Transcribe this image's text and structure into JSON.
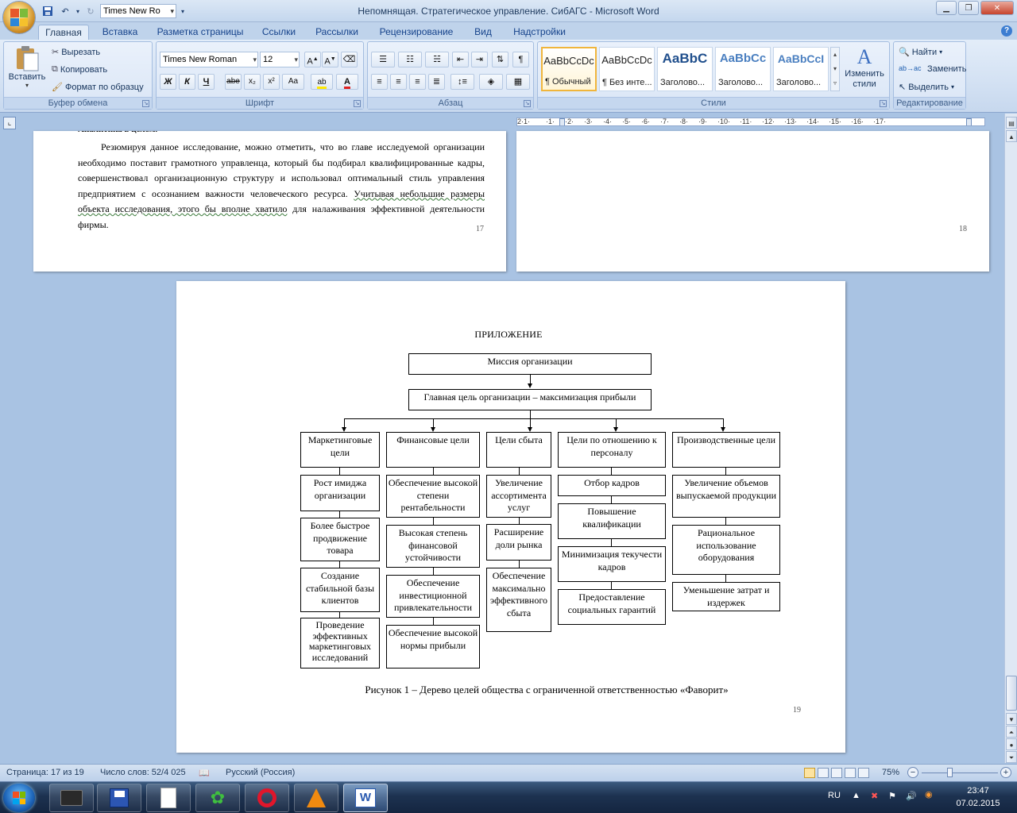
{
  "window": {
    "title": "Непомнящая. Стратегическое управление. СибАГС - Microsoft Word",
    "qat_font": "Times New Ro"
  },
  "tabs": [
    "Главная",
    "Вставка",
    "Разметка страницы",
    "Ссылки",
    "Рассылки",
    "Рецензирование",
    "Вид",
    "Надстройки"
  ],
  "ribbon": {
    "clipboard": {
      "group": "Буфер обмена",
      "paste": "Вставить",
      "cut": "Вырезать",
      "copy": "Копировать",
      "format_painter": "Формат по образцу"
    },
    "font": {
      "group": "Шрифт",
      "name": "Times New Roman",
      "size": "12",
      "bold": "Ж",
      "italic": "К",
      "underline": "Ч",
      "strike": "abe",
      "sub": "x₂",
      "sup": "x²",
      "case": "Aa"
    },
    "paragraph": {
      "group": "Абзац"
    },
    "styles": {
      "group": "Стили",
      "items": [
        {
          "sample": "AaBbCcDc",
          "name": "¶ Обычный"
        },
        {
          "sample": "AaBbCcDc",
          "name": "¶ Без инте..."
        },
        {
          "sample": "AaBbC",
          "name": "Заголово..."
        },
        {
          "sample": "AaBbCc",
          "name": "Заголово..."
        },
        {
          "sample": "AaBbCcI",
          "name": "Заголово..."
        }
      ],
      "change": "Изменить стили"
    },
    "editing": {
      "group": "Редактирование",
      "find": "Найти",
      "replace": "Заменить",
      "select": "Выделить"
    }
  },
  "pages": {
    "p17": {
      "cut_line": "Аналитика в целом.",
      "para_a": "Резюмируя данное исследование, можно отметить, что во главе исследуемой организации необходимо поставит грамотного управленца, который бы подбирал квалифицированные кадры, совершенствовал организационную структуру и использовал оптимальный стиль управления предприятием с осознанием важности человеческого ресурса.",
      "para_b": "Учитывая небольшие размеры объекта исследования, этого бы вполне хватило",
      "para_c": "для налаживания эффективной деятельности фирмы.",
      "number": "17"
    },
    "p18": {
      "number": "18"
    },
    "p19": {
      "heading": "ПРИЛОЖЕНИЕ",
      "mission": "Миссия организации",
      "main_goal": "Главная цель организации – максимизация прибыли",
      "columns": [
        {
          "title": "Маркетинговые цели",
          "items": [
            "Рост имиджа организации",
            "Более быстрое продвижение товара",
            "Создание стабильной базы клиентов",
            "Проведение эффективных маркетинговых исследований"
          ]
        },
        {
          "title": "Финансовые цели",
          "items": [
            "Обеспечение высокой степени рентабельности",
            "Высокая степень финансовой устойчивости",
            "Обеспечение инвестиционной привлекательности",
            "Обеспечение высокой нормы прибыли"
          ]
        },
        {
          "title": "Цели сбыта",
          "items": [
            "Увеличение ассортимента услуг",
            "Расширение доли рынка",
            "Обеспечение максимально эффективного сбыта"
          ]
        },
        {
          "title": "Цели по отношению к персоналу",
          "items": [
            "Отбор кадров",
            "Повышение квалификации",
            "Минимизация текучести кадров",
            "Предоставление социальных гарантий"
          ]
        },
        {
          "title": "Производственные цели",
          "items": [
            "Увеличение объемов выпускаемой продукции",
            "Рациональное использование оборудования",
            "Уменьшение затрат и издержек"
          ]
        }
      ],
      "caption": "Рисунок 1 – Дерево целей общества с ограниченной ответственностью «Фаворит»",
      "number": "19"
    }
  },
  "status": {
    "page": "Страница: 17 из 19",
    "words": "Число слов: 52/4 025",
    "language": "Русский (Россия)",
    "zoom": "75%"
  },
  "tray": {
    "lang": "RU",
    "time": "23:47",
    "date": "07.02.2015"
  },
  "colors": {
    "accent": "#15428b",
    "ribbon": "#dae6f6",
    "workspace": "#a9c3e3"
  }
}
